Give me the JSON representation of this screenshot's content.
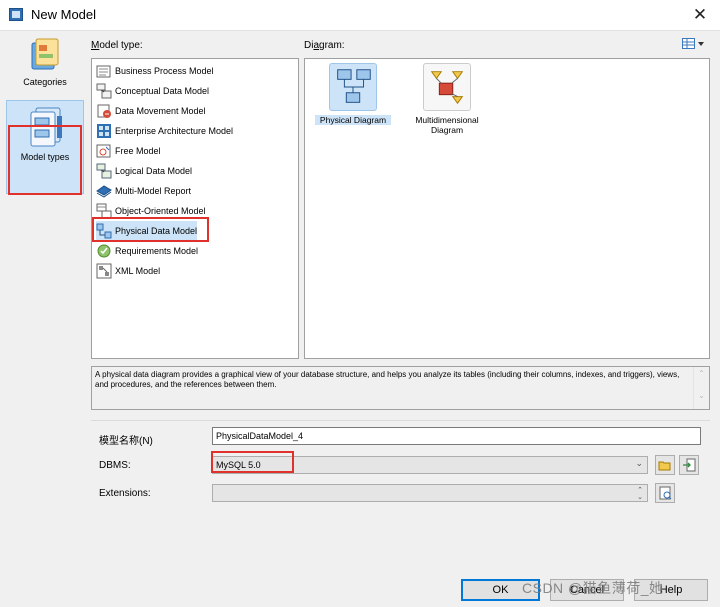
{
  "window": {
    "title": "New Model",
    "close_glyph": "✕"
  },
  "left_rail": {
    "items": [
      {
        "label": "Categories",
        "icon": "folder-icon"
      },
      {
        "label": "Model types",
        "icon": "model-types-icon"
      }
    ]
  },
  "model_type": {
    "label_prefix": "M",
    "label_rest": "odel type:",
    "items": [
      {
        "label": "Business Process Model",
        "icon": "business-process-icon"
      },
      {
        "label": "Conceptual Data Model",
        "icon": "conceptual-data-icon"
      },
      {
        "label": "Data Movement Model",
        "icon": "data-movement-icon"
      },
      {
        "label": "Enterprise Architecture Model",
        "icon": "enterprise-architecture-icon"
      },
      {
        "label": "Free Model",
        "icon": "free-model-icon"
      },
      {
        "label": "Logical Data Model",
        "icon": "logical-data-icon"
      },
      {
        "label": "Multi-Model Report",
        "icon": "report-icon"
      },
      {
        "label": "Object-Oriented Model",
        "icon": "object-oriented-icon"
      },
      {
        "label": "Physical Data Model",
        "icon": "physical-data-icon"
      },
      {
        "label": "Requirements Model",
        "icon": "requirements-icon"
      },
      {
        "label": "XML Model",
        "icon": "xml-icon"
      }
    ],
    "selected_index": 8
  },
  "diagram": {
    "label_prefix": "Di",
    "label_underlined": "a",
    "label_rest": "gram:",
    "items": [
      {
        "line1": "Physical Diagram",
        "line2": "",
        "icon": "physical-diagram-icon"
      },
      {
        "line1": "Multidimensional",
        "line2": "Diagram",
        "icon": "multidimensional-diagram-icon"
      }
    ]
  },
  "description": "A physical data diagram provides a graphical view of your database structure, and helps you analyze its tables (including their columns, indexes, and triggers), views, and procedures, and the references between them.",
  "form": {
    "model_name_label": "模型名称(N)",
    "model_name_value": "PhysicalDataModel_4",
    "dbms_label": "DBMS:",
    "dbms_value": "MySQL 5.0",
    "extensions_label": "Extensions:",
    "extensions_value": ""
  },
  "buttons": {
    "ok": "OK",
    "cancel": "Cancel",
    "help": "Help"
  },
  "watermark": "CSDN @猫鱼薄荷_她",
  "colors": {
    "highlight_red": "#e0312d",
    "selection_blue": "#cde3f7",
    "accent": "#0078d7"
  }
}
